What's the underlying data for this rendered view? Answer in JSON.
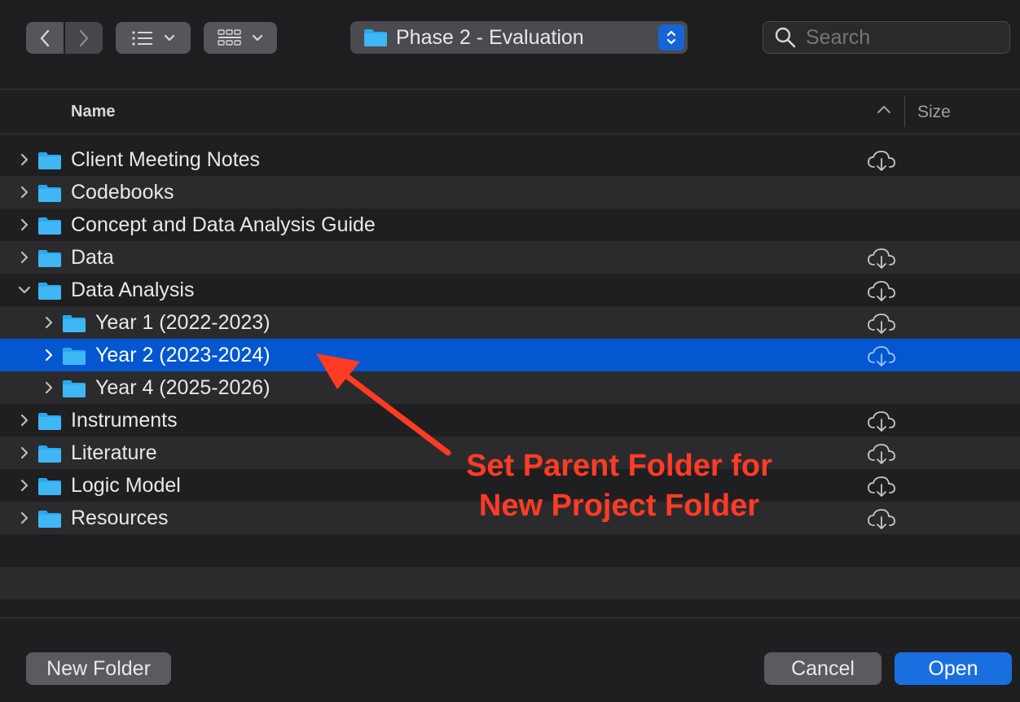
{
  "toolbar": {
    "nav_back_icon": "chevron-left-icon",
    "nav_forward_icon": "chevron-right-icon",
    "list_view_icon": "list-icon",
    "grid_view_icon": "grid-icon",
    "path_title": "Phase 2 - Evaluation",
    "search_placeholder": "Search"
  },
  "columns": {
    "name": "Name",
    "size": "Size"
  },
  "rows": [
    {
      "label": "Client Meeting Notes",
      "level": 0,
      "expanded": false,
      "cloud": true
    },
    {
      "label": "Codebooks",
      "level": 0,
      "expanded": false,
      "cloud": false
    },
    {
      "label": "Concept and Data Analysis Guide",
      "level": 0,
      "expanded": false,
      "cloud": false
    },
    {
      "label": "Data",
      "level": 0,
      "expanded": false,
      "cloud": true
    },
    {
      "label": "Data Analysis",
      "level": 0,
      "expanded": true,
      "cloud": true
    },
    {
      "label": "Year 1 (2022-2023)",
      "level": 1,
      "expanded": false,
      "cloud": true
    },
    {
      "label": "Year 2 (2023-2024)",
      "level": 1,
      "expanded": false,
      "cloud": true,
      "selected": true
    },
    {
      "label": "Year 4 (2025-2026)",
      "level": 1,
      "expanded": false,
      "cloud": false
    },
    {
      "label": "Instruments",
      "level": 0,
      "expanded": false,
      "cloud": true
    },
    {
      "label": "Literature",
      "level": 0,
      "expanded": false,
      "cloud": true
    },
    {
      "label": "Logic Model",
      "level": 0,
      "expanded": false,
      "cloud": true
    },
    {
      "label": "Resources",
      "level": 0,
      "expanded": false,
      "cloud": true
    }
  ],
  "footer": {
    "new_folder": "New Folder",
    "cancel": "Cancel",
    "open": "Open"
  },
  "annotation": {
    "line1": "Set Parent Folder for",
    "line2": "New Project Folder",
    "color": "#ff3b24"
  },
  "colors": {
    "selection": "#0457d1",
    "accent_button": "#1a6fe0",
    "folder": "#29a8ef"
  }
}
